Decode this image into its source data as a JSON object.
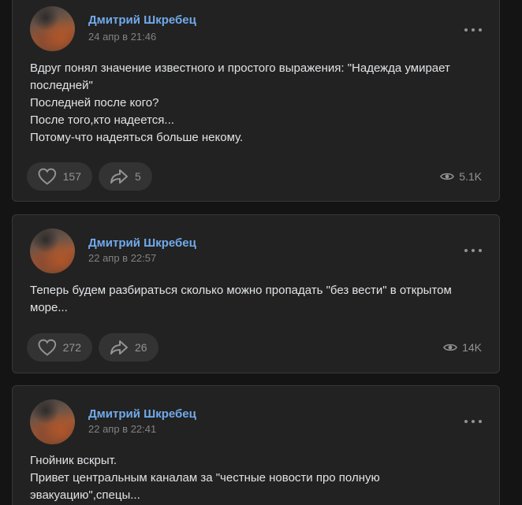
{
  "posts": [
    {
      "author": "Дмитрий Шкребец",
      "date": "24 апр в 21:46",
      "lines": [
        "Вдруг понял значение известного и простого выражения: \"Надежда умирает",
        "последней\"",
        "Последней после кого?",
        "После того,кто надеется...",
        "Потому-что надеяться больше некому."
      ],
      "likes": "157",
      "shares": "5",
      "views": "5.1K"
    },
    {
      "author": "Дмитрий Шкребец",
      "date": "22 апр в 22:57",
      "lines": [
        "Теперь будем разбираться сколько можно пропадать \"без вести\" в открытом",
        "море..."
      ],
      "likes": "272",
      "shares": "26",
      "views": "14K"
    },
    {
      "author": "Дмитрий Шкребец",
      "date": "22 апр в 22:41",
      "lines": [
        "Гнойник вскрыт.",
        "Привет центральным каналам за \"честные новости про полную",
        "эвакуацию\",спецы..."
      ]
    }
  ]
}
